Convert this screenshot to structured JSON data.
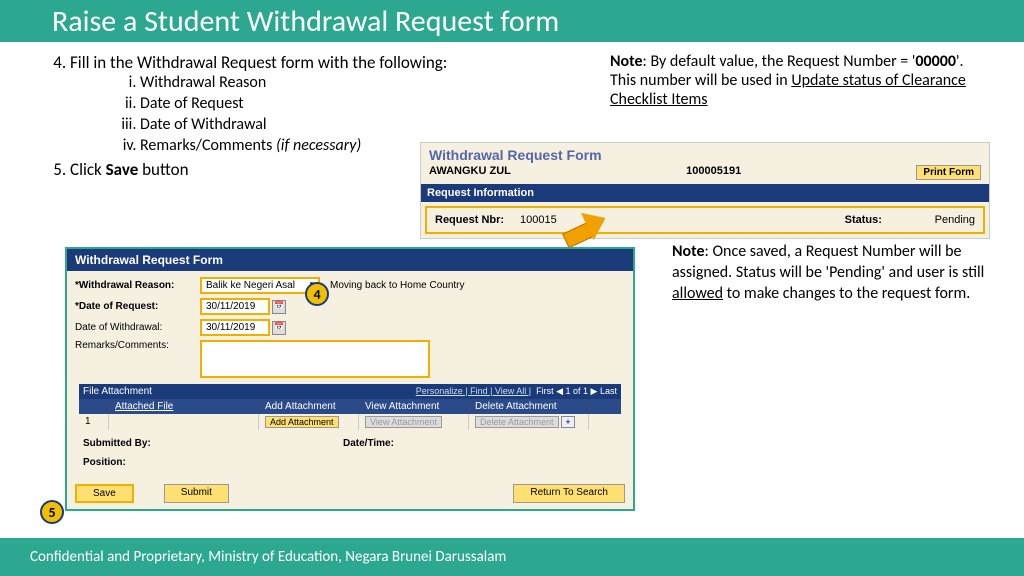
{
  "title": "Raise a Student Withdrawal Request form",
  "step4": {
    "num": "4.",
    "text": "Fill in the Withdrawal Request form with the following:",
    "items": [
      "Withdrawal Reason",
      "Date of Request",
      "Date of Withdrawal",
      "Remarks/Comments "
    ],
    "italic": "(if necessary)"
  },
  "step5": {
    "num": "5.",
    "prefix": "Click ",
    "bold": "Save",
    "suffix": " button"
  },
  "note1": {
    "bold": "Note",
    "t1": ": By default value, the Request Number = '",
    "b2": "00000",
    "t2": "'. This number will be used in ",
    "u": "Update status of Clearance Checklist Items"
  },
  "note2": {
    "bold": "Note",
    "t1": ": Once saved, a Request Number will be assigned. Status will be 'Pending' and user is still ",
    "u": "allowed",
    "t2": " to make changes to the request form."
  },
  "inset1": {
    "title": "Withdrawal Request Form",
    "name": "AWANGKU ZUL",
    "id": "100005191",
    "print": "Print Form",
    "section": "Request Information",
    "req_lbl": "Request Nbr:",
    "req_val": "100015",
    "stat_lbl": "Status:",
    "stat_val": "Pending"
  },
  "inset2": {
    "title": "Withdrawal Request Form",
    "reason_lbl": "*Withdrawal Reason:",
    "reason_val": "Balik ke Negeri Asal",
    "reason_desc": "Moving back to Home Country",
    "dor_lbl": "*Date of Request:",
    "dor_val": "30/11/2019",
    "dow_lbl": "Date of Withdrawal:",
    "dow_val": "30/11/2019",
    "rem_lbl": "Remarks/Comments:",
    "fa_title": "File Attachment",
    "fa_links": "Personalize | Find | View All |",
    "fa_page": "First ◀ 1 of 1 ▶ Last",
    "col_file": "Attached File",
    "col_add": "Add Attachment",
    "col_view": "View Attachment",
    "col_del": "Delete Attachment",
    "row_num": "1",
    "btn_add": "Add Attachment",
    "btn_view": "View Attachment",
    "btn_del": "Delete Attachment",
    "sub_lbl": "Submitted By:",
    "dt_lbl": "Date/Time:",
    "pos_lbl": "Position:",
    "save": "Save",
    "submit": "Submit",
    "rts": "Return To Search"
  },
  "callouts": {
    "c4": "4",
    "c5": "5"
  },
  "footer": "Confidential and Proprietary, Ministry of Education, Negara Brunei Darussalam"
}
